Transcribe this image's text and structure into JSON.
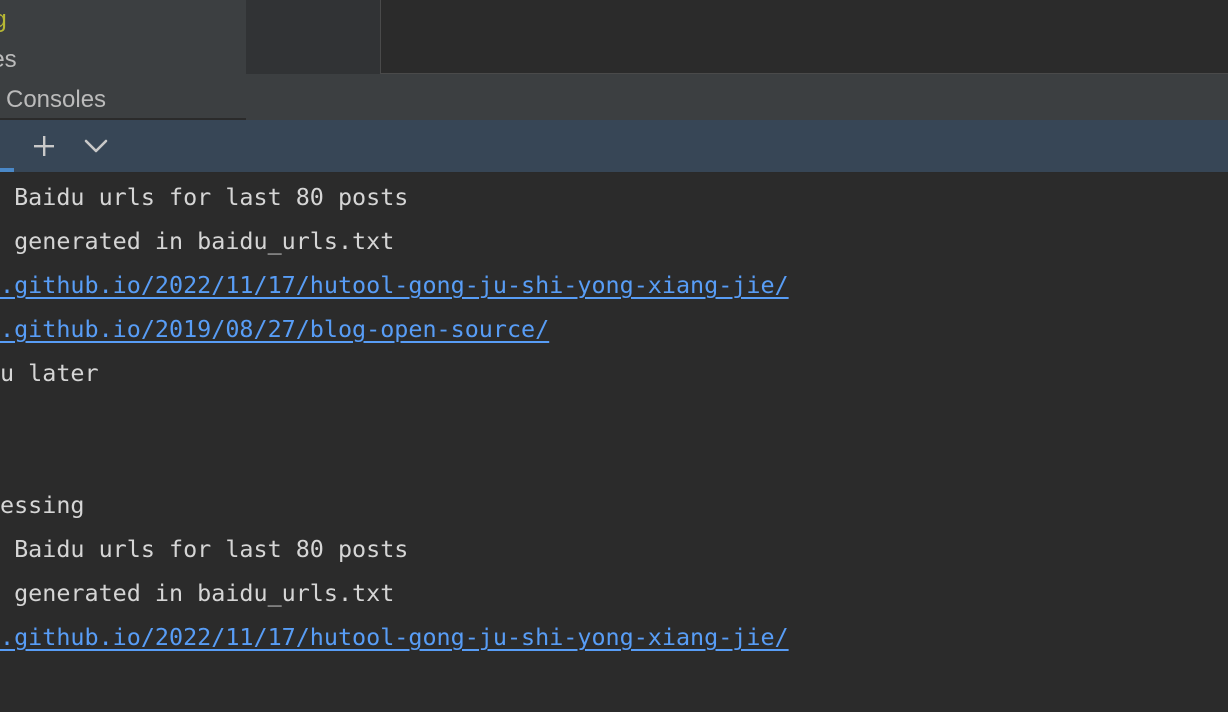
{
  "project_tree": {
    "items": [
      {
        "label": "og"
      },
      {
        "label": "ies"
      },
      {
        "label": "Consoles"
      }
    ]
  },
  "run_toolbar": {
    "buttons": [
      {
        "icon": "plus-icon"
      },
      {
        "icon": "chevron-down-icon"
      }
    ]
  },
  "console": {
    "lines": [
      {
        "text": " Baidu urls for last 80 posts",
        "type": "text"
      },
      {
        "text": " generated in baidu_urls.txt",
        "type": "text"
      },
      {
        "text": ".github.io/2022/11/17/hutool-gong-ju-shi-yong-xiang-jie/",
        "type": "link"
      },
      {
        "text": ".github.io/2019/08/27/blog-open-source/",
        "type": "link"
      },
      {
        "text": "u later",
        "type": "text"
      },
      {
        "text": "",
        "type": "text"
      },
      {
        "text": "",
        "type": "text"
      },
      {
        "text": "essing",
        "type": "text"
      },
      {
        "text": " Baidu urls for last 80 posts",
        "type": "text"
      },
      {
        "text": " generated in baidu_urls.txt",
        "type": "text"
      },
      {
        "text": ".github.io/2022/11/17/hutool-gong-ju-shi-yong-xiang-jie/",
        "type": "link"
      }
    ]
  },
  "colors": {
    "console_bg": "#2b2b2b",
    "toolbar_bg": "#374656",
    "panel_bg": "#3c3f41",
    "text": "#d5d5d5",
    "link": "#589df6",
    "highlight_yellow": "#b8b834",
    "accent": "#4a88c7"
  }
}
